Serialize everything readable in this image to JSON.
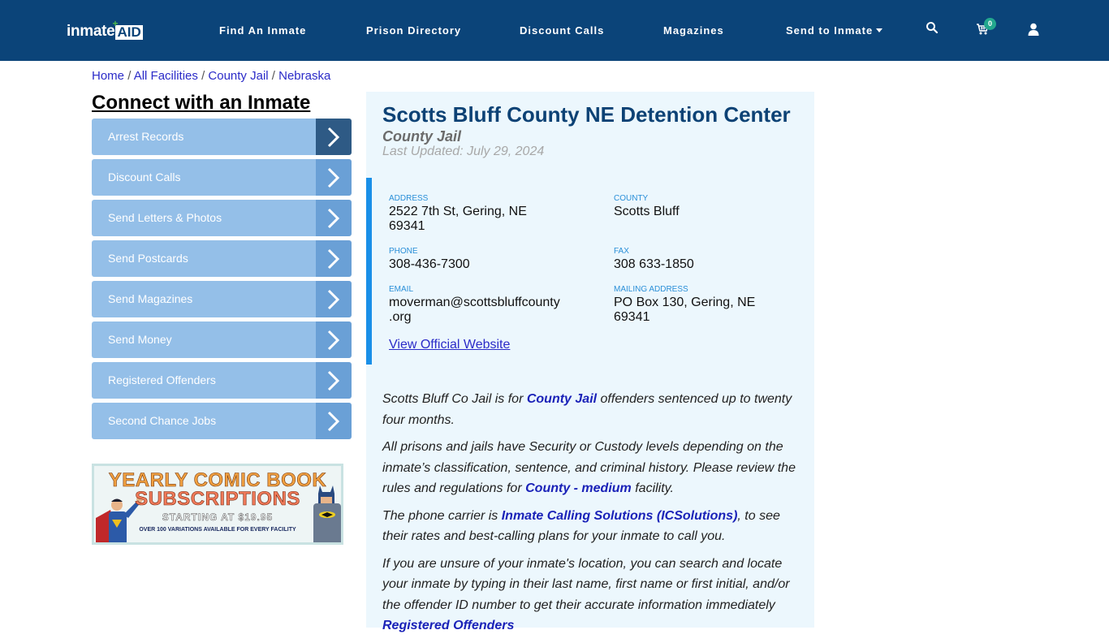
{
  "header": {
    "logo_text": "inmate",
    "logo_badge": "AID",
    "logo_plus": "+",
    "nav": [
      {
        "label": "Find An Inmate"
      },
      {
        "label": "Prison Directory"
      },
      {
        "label": "Discount Calls"
      },
      {
        "label": "Magazines"
      },
      {
        "label": "Send to Inmate",
        "has_dropdown": true
      }
    ],
    "icons": [
      "search-icon",
      "cart-icon",
      "user-icon"
    ],
    "cart_count": "0"
  },
  "breadcrumb": {
    "items": [
      "Home",
      "All Facilities",
      "County Jail",
      "Nebraska"
    ],
    "separator": "/"
  },
  "sidebar": {
    "title": "Connect with an Inmate",
    "items": [
      {
        "label": "Arrest Records"
      },
      {
        "label": "Discount Calls"
      },
      {
        "label": "Send Letters & Photos"
      },
      {
        "label": "Send Postcards"
      },
      {
        "label": "Send Magazines"
      },
      {
        "label": "Send Money"
      },
      {
        "label": "Registered Offenders"
      },
      {
        "label": "Second Chance Jobs"
      }
    ],
    "ad": {
      "line1": "YEARLY COMIC BOOK",
      "line2": "SUBSCRIPTIONS",
      "line3": "STARTING AT $19.95",
      "line4": "OVER 100 VARIATIONS AVAILABLE FOR EVERY FACILITY"
    }
  },
  "facility": {
    "name": "Scotts Bluff County NE Detention Center",
    "type": "County Jail",
    "last_updated": "Last Updated: July 29, 2024",
    "fields": {
      "address": {
        "label": "Address",
        "line1": "2522 7th St, Gering, NE",
        "line2": "69341"
      },
      "county": {
        "label": "County",
        "line1": "Scotts Bluff"
      },
      "phone": {
        "label": "Phone",
        "line1": "308-436-7300"
      },
      "fax": {
        "label": "Fax",
        "line1": "308 633-1850"
      },
      "email": {
        "label": "Email",
        "line1": "moverman@scottsbluffcounty",
        "line2": ".org"
      },
      "mailing": {
        "label": "Mailing Address",
        "line1": "PO Box 130, Gering, NE",
        "line2": "69341"
      }
    },
    "official_link": "View Official Website"
  },
  "description": {
    "p1": {
      "before": "Scotts Bluff Co Jail is for ",
      "link": "County Jail",
      "after": " offenders sentenced up to twenty four months."
    },
    "p2": {
      "before": "All prisons and jails have Security or Custody levels depending on the inmate’s classification, sentence, and criminal history. Please review the rules and regulations for ",
      "link": "County - medium",
      "after": " facility."
    },
    "p3": {
      "before": "The phone carrier is ",
      "link": "Inmate Calling Solutions (ICSolutions)",
      "after": ", to see their rates and best-calling plans for your inmate to call you."
    },
    "p4": {
      "before": "If you are unsure of your inmate's location, you can search and locate your inmate by typing in their last name, first name or first initial, and/or the offender ID number to get their accurate information immediately ",
      "link": "Registered Offenders"
    }
  },
  "colors": {
    "header_bg": "#0b4479",
    "sidebar_item": "#94bfe8",
    "sidebar_arrow": "#6aa0d6",
    "sidebar_arrow_active": "#2e5a85",
    "panel_bg": "#ecf7fd",
    "accent_bar": "#1a8fe8",
    "badge": "#23a88e",
    "title": "#0d4275"
  }
}
